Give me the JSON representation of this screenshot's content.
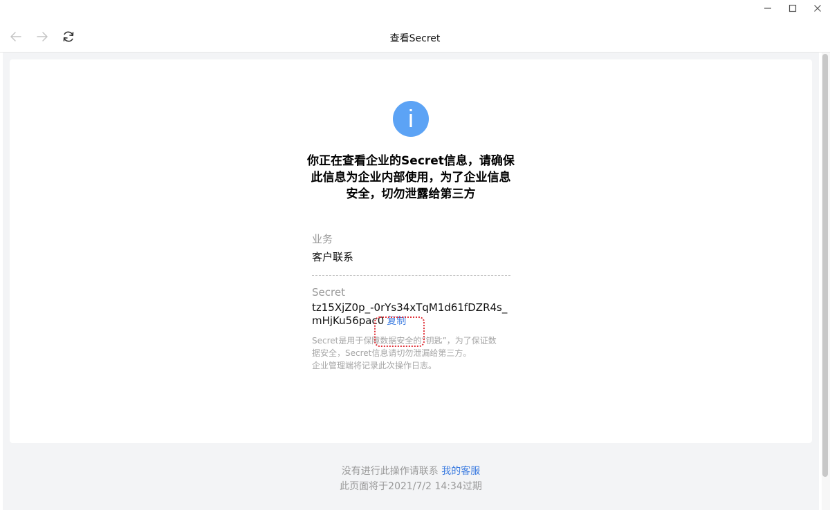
{
  "window": {
    "minimize_icon": "minimize-icon",
    "maximize_icon": "maximize-icon",
    "close_icon": "close-icon"
  },
  "toolbar": {
    "title": "查看Secret",
    "back_icon": "arrow-left-icon",
    "forward_icon": "arrow-right-icon",
    "refresh_icon": "refresh-icon"
  },
  "main": {
    "info_icon_glyph": "i",
    "headline": "你正在查看企业的Secret信息，请确保此信息为企业内部使用，为了企业信息安全，切勿泄露给第三方",
    "business": {
      "label": "业务",
      "value": "客户联系"
    },
    "secret": {
      "label": "Secret",
      "value": "tz15XjZ0p_-0rYs34xTqM1d61fDZR4s_mHjKu56pac0",
      "copy_label": "复制",
      "hint_line1": "Secret是用于保障数据安全的“钥匙”，为了保证数",
      "hint_line2": "据安全，Secret信息请切勿泄漏给第三方。",
      "hint_line3": "企业管理端将记录此次操作日志。"
    }
  },
  "footer": {
    "no_action_text": "没有进行此操作请联系 ",
    "support_link": "我的客服",
    "expire_text": "此页面将于2021/7/2 14:34过期"
  },
  "colors": {
    "accent": "#3b7be0",
    "info_icon_bg": "#5ca3f5",
    "highlight_border": "#e0333a"
  }
}
